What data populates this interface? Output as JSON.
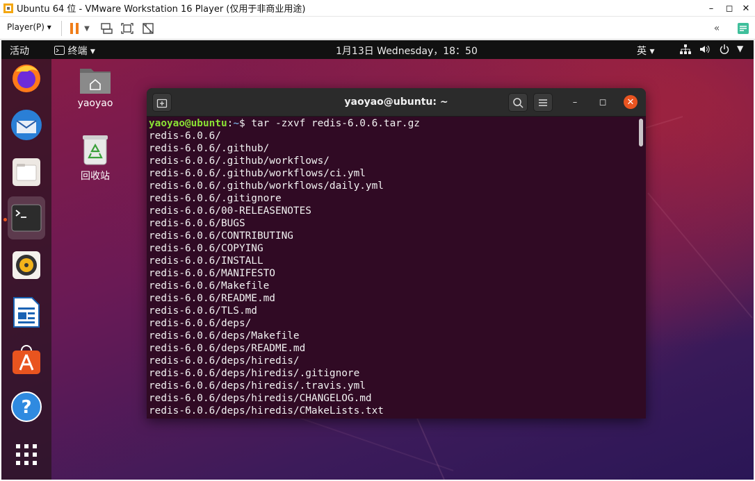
{
  "vm": {
    "title": "Ubuntu 64 位 - VMware Workstation 16 Player (仅用于非商业用途)",
    "player_menu": "Player(P)",
    "toolbar_icons": [
      "pause-icon",
      "dropdown-arrow-icon",
      "send-ctrl-alt-del-icon",
      "fullscreen-icon",
      "unity-icon",
      "back-icon",
      "message-icon"
    ]
  },
  "topbar": {
    "activities": "活动",
    "app_menu": "终端",
    "clock": "1月13日 Wednesday，18：50",
    "input_method": "英"
  },
  "dock": {
    "apps": [
      "firefox-icon",
      "thunderbird-icon",
      "files-icon",
      "terminal-icon",
      "rhythmbox-icon",
      "libreoffice-writer-icon",
      "software-icon",
      "help-icon",
      "show-apps-icon"
    ]
  },
  "desktop": {
    "home_label": "yaoyao",
    "trash_label": "回收站"
  },
  "terminal": {
    "title": "yaoyao@ubuntu: ~",
    "prompt_user": "yaoyao@ubuntu",
    "prompt_sep": ":",
    "prompt_path": "~",
    "prompt_symbol": "$ ",
    "command": "tar -zxvf redis-6.0.6.tar.gz",
    "output": [
      "redis-6.0.6/",
      "redis-6.0.6/.github/",
      "redis-6.0.6/.github/workflows/",
      "redis-6.0.6/.github/workflows/ci.yml",
      "redis-6.0.6/.github/workflows/daily.yml",
      "redis-6.0.6/.gitignore",
      "redis-6.0.6/00-RELEASENOTES",
      "redis-6.0.6/BUGS",
      "redis-6.0.6/CONTRIBUTING",
      "redis-6.0.6/COPYING",
      "redis-6.0.6/INSTALL",
      "redis-6.0.6/MANIFESTO",
      "redis-6.0.6/Makefile",
      "redis-6.0.6/README.md",
      "redis-6.0.6/TLS.md",
      "redis-6.0.6/deps/",
      "redis-6.0.6/deps/Makefile",
      "redis-6.0.6/deps/README.md",
      "redis-6.0.6/deps/hiredis/",
      "redis-6.0.6/deps/hiredis/.gitignore",
      "redis-6.0.6/deps/hiredis/.travis.yml",
      "redis-6.0.6/deps/hiredis/CHANGELOG.md",
      "redis-6.0.6/deps/hiredis/CMakeLists.txt"
    ]
  }
}
